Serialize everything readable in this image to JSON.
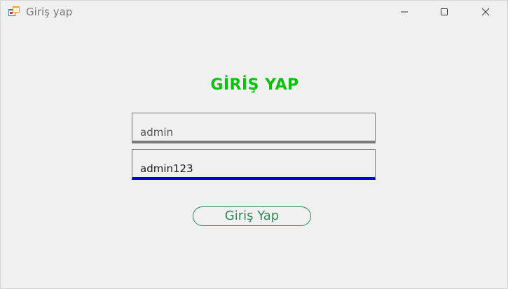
{
  "window": {
    "title": "Giriş yap",
    "app_icon": "form-icon",
    "minimize_icon": "minimize-icon",
    "maximize_icon": "maximize-icon",
    "close_icon": "close-icon"
  },
  "form": {
    "heading": "GİRİŞ YAP",
    "heading_color": "#0ac20a",
    "username_value": "admin",
    "password_value": "admin123",
    "focused_field_accent": "#0000d8",
    "submit_label": "Giriş Yap",
    "submit_color": "#2e8b57"
  }
}
